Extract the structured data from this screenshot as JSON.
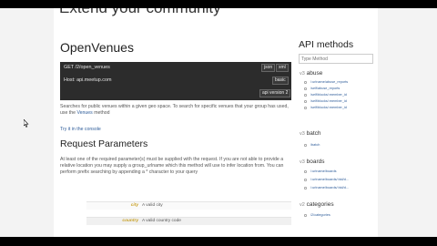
{
  "page": {
    "cut_heading": "Extend your community"
  },
  "main": {
    "title": "OpenVenues",
    "code": {
      "request": "GET /2/open_venues",
      "host": "Host: api.meetup.com",
      "format_json": "json",
      "format_xml": "xml",
      "auth": "basic",
      "version": "api version 2"
    },
    "description": {
      "part1": "Searches for public venues within a given geo space. To search for specific venues that your group has used, use the ",
      "link": "Venues",
      "part2": " method"
    },
    "try_link": "Try it in the console",
    "params_heading": "Request Parameters",
    "params_intro": "At least one of the required parameter(s) must be supplied with the request. If you are not able to provide a relative location you may supply a group_urlname which this method will use to infer location from. You can perform prefix searching by appending a * character to your query",
    "params": [
      {
        "name": "city",
        "desc": "A valid city"
      },
      {
        "name": "country",
        "desc": "A valid country code"
      }
    ]
  },
  "sidebar": {
    "title": "API methods",
    "search_placeholder": "Type Method",
    "groups": [
      {
        "version": "v3",
        "name": "abuse",
        "items": [
          "/:urlname/abuse_reports",
          "/self/abuse_reports",
          "/self/blocks/:member_id",
          "/self/blocks/:member_id",
          "/self/blocks/:member_id"
        ]
      },
      {
        "version": "v3",
        "name": "batch",
        "items": [
          "/batch"
        ]
      },
      {
        "version": "v3",
        "name": "boards",
        "items": [
          "/:urlname/boards",
          "/:urlname/boards/:bid/d...",
          "/:urlname/boards/:bid/d..."
        ]
      },
      {
        "version": "v2",
        "name": "categories",
        "items": [
          "/2/categories"
        ]
      }
    ]
  }
}
